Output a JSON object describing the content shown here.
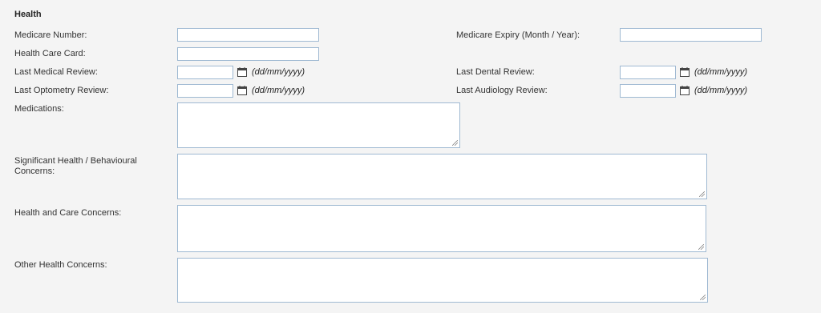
{
  "section": {
    "title": "Health"
  },
  "fields": {
    "medicare_number": {
      "label": "Medicare Number:",
      "value": ""
    },
    "medicare_expiry": {
      "label": "Medicare Expiry (Month / Year):",
      "value": ""
    },
    "health_care_card": {
      "label": "Health Care Card:",
      "value": ""
    },
    "last_medical_review": {
      "label": "Last Medical Review:",
      "value": "",
      "hint": "(dd/mm/yyyy)"
    },
    "last_dental_review": {
      "label": "Last Dental Review:",
      "value": "",
      "hint": "(dd/mm/yyyy)"
    },
    "last_optometry_review": {
      "label": "Last Optometry Review:",
      "value": "",
      "hint": "(dd/mm/yyyy)"
    },
    "last_audiology_review": {
      "label": "Last Audiology Review:",
      "value": "",
      "hint": "(dd/mm/yyyy)"
    },
    "medications": {
      "label": "Medications:",
      "value": ""
    },
    "significant_concerns": {
      "label_line1": "Significant Health / Behavioural",
      "label_line2": "Concerns:",
      "value": ""
    },
    "health_care_concerns": {
      "label": "Health and Care Concerns:",
      "value": ""
    },
    "other_health_concerns": {
      "label": "Other Health Concerns:",
      "value": ""
    }
  },
  "icons": {
    "calendar": "calendar-icon",
    "resize": "resize-grip-icon"
  },
  "colors": {
    "input_border": "#9fb9d2",
    "background": "#f4f4f4"
  }
}
